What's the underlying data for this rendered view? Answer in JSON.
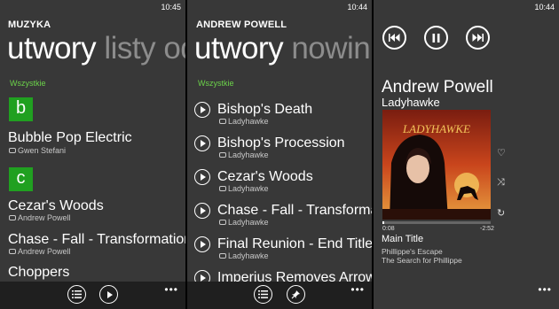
{
  "screen1": {
    "clock": "10:45",
    "app_title": "MUZYKA",
    "pivot_active": "utwory",
    "pivot_next": "listy odt",
    "filter": "Wszystkie",
    "groups": [
      {
        "letter": "b",
        "songs": [
          {
            "title": "Bubble Pop Electric",
            "artist": "Gwen Stefani"
          }
        ]
      },
      {
        "letter": "c",
        "songs": [
          {
            "title": "Cezar's Woods",
            "artist": "Andrew Powell"
          },
          {
            "title": "Chase - Fall - Transformation",
            "artist": "Andrew Powell"
          },
          {
            "title": "Choppers",
            "artist": ""
          }
        ]
      }
    ],
    "appbar_icons": [
      "list-icon",
      "play-icon"
    ]
  },
  "screen2": {
    "clock": "10:44",
    "app_title": "ANDREW POWELL",
    "pivot_active": "utwory",
    "pivot_next": "nowinki",
    "filter": "Wszystkie",
    "songs": [
      {
        "title": "Bishop's Death",
        "album": "Ladyhawke"
      },
      {
        "title": "Bishop's Procession",
        "album": "Ladyhawke"
      },
      {
        "title": "Cezar's Woods",
        "album": "Ladyhawke"
      },
      {
        "title": "Chase - Fall - Transformation",
        "album": "Ladyhawke"
      },
      {
        "title": "Final Reunion - End Title",
        "album": "Ladyhawke"
      },
      {
        "title": "Imperius Removes Arrow",
        "album": ""
      }
    ],
    "appbar_icons": [
      "list-icon",
      "pin-icon"
    ]
  },
  "screen3": {
    "clock": "10:44",
    "artist": "Andrew Powell",
    "album": "Ladyhawke",
    "cover_title": "LADYHAWKE",
    "elapsed": "0:08",
    "remaining": "-2:52",
    "progress": 0.02,
    "song": "Main Title",
    "track_album": "Phillippe's Escape",
    "track_sub": "The Search for Phillippe"
  },
  "colors": {
    "accent": "#20a020",
    "filter_text": "#6cd34a",
    "background": "#383838",
    "appbar": "#1f1f1f"
  }
}
